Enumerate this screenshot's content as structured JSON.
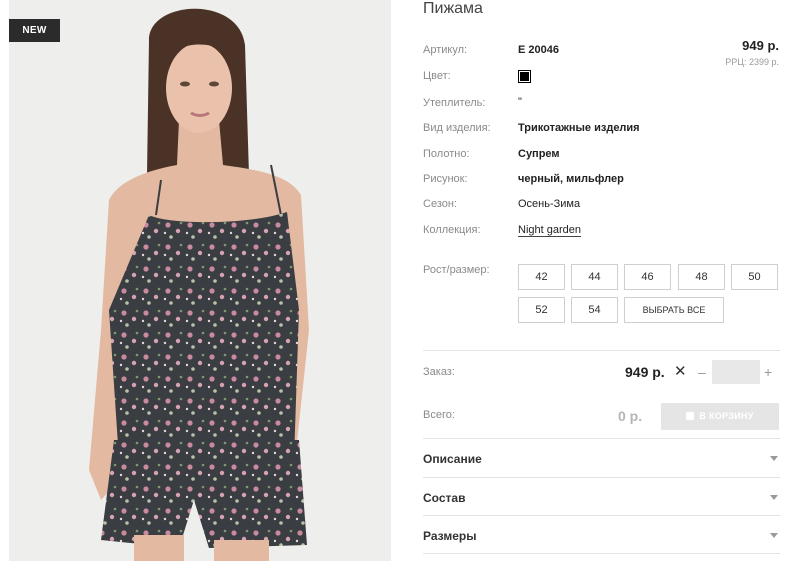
{
  "badge": "NEW",
  "product": {
    "title": "Пижама",
    "price": "949 р.",
    "rrp": "РРЦ: 2399 р."
  },
  "attributes": [
    {
      "label": "Артикул:",
      "value": "Е 20046"
    },
    {
      "label": "Цвет:",
      "value": "",
      "color": "#000000"
    },
    {
      "label": "Утеплитель:",
      "value": "\""
    },
    {
      "label": "Вид изделия:",
      "value": "Трикотажные изделия"
    },
    {
      "label": "Полотно:",
      "value": "Супрем"
    },
    {
      "label": "Рисунок:",
      "value": "черный, мильфлер"
    },
    {
      "label": "Сезон:",
      "value": "Осень-Зима"
    },
    {
      "label": "Коллекция:",
      "value": "Night garden"
    }
  ],
  "sizes": {
    "label": "Рост/размер:",
    "options": [
      "42",
      "44",
      "46",
      "48",
      "50",
      "52",
      "54"
    ],
    "select_all": "ВЫБРАТЬ ВСЕ"
  },
  "order": {
    "label": "Заказ:",
    "price": "949 р.",
    "times": "✕",
    "minus": "–",
    "plus": "+",
    "quantity": ""
  },
  "total": {
    "label": "Всего:",
    "value": "0 р.",
    "cart_button": "В КОРЗИНУ"
  },
  "accordions": [
    "Описание",
    "Состав",
    "Размеры"
  ]
}
